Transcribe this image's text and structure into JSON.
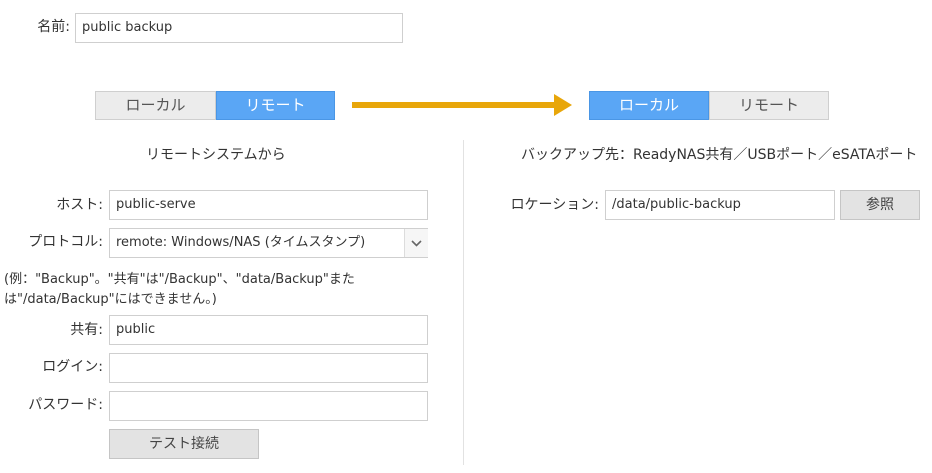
{
  "name": {
    "label": "名前:",
    "value": "public backup"
  },
  "source_toggle": {
    "local": "ローカル",
    "remote": "リモート",
    "selected": "remote"
  },
  "dest_toggle": {
    "local": "ローカル",
    "remote": "リモート",
    "selected": "local"
  },
  "arrow_color": "#e8a60a",
  "source": {
    "heading": "リモートシステムから",
    "host_label": "ホスト:",
    "host_value": "public-serve",
    "protocol_label": "プロトコル:",
    "protocol_value": "remote: Windows/NAS (タイムスタンプ)",
    "hint_line1": "(例：\"Backup\"。\"共有\"は\"/Backup\"、\"data/Backup\"また",
    "hint_line2": "は\"/data/Backup\"にはできません。)",
    "share_label": "共有:",
    "share_value": "public",
    "login_label": "ログイン:",
    "login_value": "",
    "password_label": "パスワード:",
    "password_value": "",
    "test_button": "テスト接続"
  },
  "destination": {
    "heading": "バックアップ先：ReadyNAS共有／USBポート／eSATAポート",
    "location_label": "ロケーション:",
    "location_value": "/data/public-backup",
    "browse_button": "参照"
  }
}
